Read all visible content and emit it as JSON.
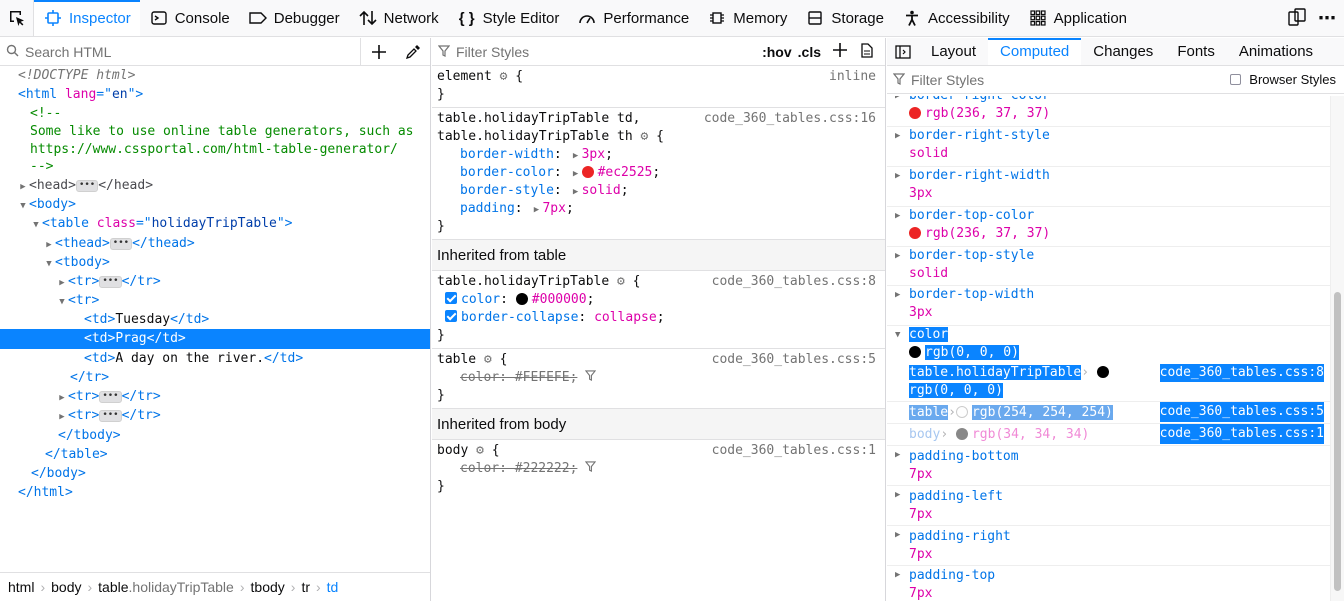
{
  "toolbar": {
    "tabs": [
      {
        "label": "Inspector",
        "icon": "inspector-icon"
      },
      {
        "label": "Console",
        "icon": "console-icon"
      },
      {
        "label": "Debugger",
        "icon": "debugger-icon"
      },
      {
        "label": "Network",
        "icon": "network-icon"
      },
      {
        "label": "Style Editor",
        "icon": "style-editor-icon"
      },
      {
        "label": "Performance",
        "icon": "performance-icon"
      },
      {
        "label": "Memory",
        "icon": "memory-icon"
      },
      {
        "label": "Storage",
        "icon": "storage-icon"
      },
      {
        "label": "Accessibility",
        "icon": "accessibility-icon"
      },
      {
        "label": "Application",
        "icon": "application-icon"
      }
    ],
    "selected": "Inspector"
  },
  "markup": {
    "search_placeholder": "Search HTML",
    "lines": {
      "l1": "<!DOCTYPE html>",
      "l2a": "<html ",
      "l2b": "lang",
      "l2c": "=\"",
      "l2d": "en",
      "l2e": "\">",
      "l3": "<!--",
      "l4": "Some like to use online table generators, such as",
      "l5": "https://www.cssportal.com/html-table-generator/",
      "l6": "-->",
      "l7a": "<head>",
      "l7b": "</head>",
      "l8": "<body>",
      "l9a": "<table ",
      "l9b": "class",
      "l9c": "=\"",
      "l9d": "holidayTripTable",
      "l9e": "\">",
      "l10a": "<thead>",
      "l10b": "</thead>",
      "l11": "<tbody>",
      "l12a": "<tr>",
      "l12b": "</tr>",
      "l13": "<tr>",
      "l14a": "<td>",
      "l14b": "Tuesday",
      "l14c": "</td>",
      "l15a": "<td>",
      "l15b": "Prag",
      "l15c": "</td>",
      "l16a": "<td>",
      "l16b": "A day on the river.",
      "l16c": "</td>",
      "l17": "</tr>",
      "l18a": "<tr>",
      "l18b": "</tr>",
      "l19a": "<tr>",
      "l19b": "</tr>",
      "l20": "</tbody>",
      "l21": "</table>",
      "l22": "</body>",
      "l23": "</html>"
    },
    "breadcrumbs": {
      "c1": "html",
      "c2": "body",
      "c3a": "table",
      "c3b": ".holidayTripTable",
      "c4": "tbody",
      "c5": "tr",
      "c6": "td"
    }
  },
  "rules": {
    "filter_placeholder": "Filter Styles",
    "hov": ":hov",
    "cls": ".cls",
    "element": {
      "selector": "element",
      "brace_open": "{",
      "source": "inline",
      "brace_close": "}"
    },
    "r1": {
      "sel1": "table.holidayTripTable td,",
      "sel2": "table.holidayTripTable th",
      "source": "code_360_tables.css:16",
      "p1n": "border-width",
      "p1v": "3px",
      "p2n": "border-color",
      "p2v": "#ec2525",
      "p3n": "border-style",
      "p3v": "solid",
      "p4n": "padding",
      "p4v": "7px"
    },
    "inh_table": "Inherited from table",
    "r2": {
      "sel": "table.holidayTripTable",
      "source": "code_360_tables.css:8",
      "p1n": "color",
      "p1v": "#000000",
      "p2n": "border-collapse",
      "p2v": "collapse"
    },
    "r3": {
      "sel": "table",
      "source": "code_360_tables.css:5",
      "p1": "color: #FEFEFE;"
    },
    "inh_body": "Inherited from body",
    "r4": {
      "sel": "body",
      "source": "code_360_tables.css:1",
      "p1": "color: #222222;"
    },
    "colon": ":",
    "semi": ";",
    "open": "{",
    "close": "}"
  },
  "sidebar": {
    "tabs": [
      "Layout",
      "Computed",
      "Changes",
      "Fonts",
      "Animations"
    ],
    "selected": "Computed",
    "filter_placeholder": "Filter Styles",
    "browser_styles": "Browser Styles",
    "props": {
      "p0n": "border-right-color",
      "p0v": "rgb(236, 37, 37)",
      "p1n": "border-right-style",
      "p1v": "solid",
      "p2n": "border-right-width",
      "p2v": "3px",
      "p3n": "border-top-color",
      "p3v": "rgb(236, 37, 37)",
      "p4n": "border-top-style",
      "p4v": "solid",
      "p5n": "border-top-width",
      "p5v": "3px",
      "p6n": "color",
      "p6v": "rgb(0, 0, 0)",
      "m1s": "table.holidayTripTable",
      "m1v": "rgb(0, 0, 0)",
      "m1src": "code_360_tables.css:8",
      "m2s": "table",
      "m2v": "rgb(254, 254, 254)",
      "m2src": "code_360_tables.css:5",
      "m3s": "body",
      "m3v": "rgb(34, 34, 34)",
      "m3src": "code_360_tables.css:1",
      "p7n": "padding-bottom",
      "p7v": "7px",
      "p8n": "padding-left",
      "p8v": "7px",
      "p9n": "padding-right",
      "p9v": "7px",
      "p10n": "padding-top",
      "p10v": "7px"
    }
  },
  "colors": {
    "accent": "#0a84ff",
    "red": "#ec2525",
    "tag": "#0074e8",
    "attr": "#dd00a9",
    "comment": "#058b00"
  }
}
